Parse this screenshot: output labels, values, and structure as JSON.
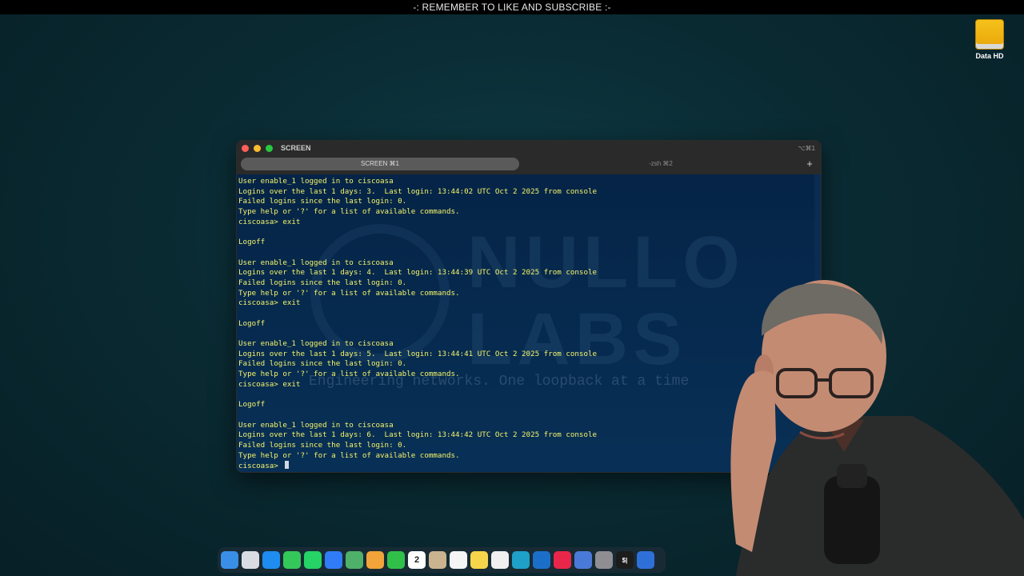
{
  "banner": "-: REMEMBER TO LIKE AND SUBSCRIBE :-",
  "desktop": {
    "drive_label": "Data HD"
  },
  "window": {
    "title": "SCREEN",
    "shortcut": "⌥⌘1",
    "tabs": [
      {
        "label": "SCREEN ⌘1",
        "active": true
      },
      {
        "label": "-zsh ⌘2",
        "active": false
      }
    ],
    "add_tab": "+"
  },
  "watermark": {
    "line1": "NULLO",
    "line2": "LABS",
    "tagline": "Engineering networks. One loopback at a time"
  },
  "terminal": {
    "lines": [
      "User enable_1 logged in to ciscoasa",
      "Logins over the last 1 days: 3.  Last login: 13:44:02 UTC Oct 2 2025 from console",
      "Failed logins since the last login: 0.",
      "Type help or '?' for a list of available commands.",
      "ciscoasa> exit",
      "",
      "Logoff",
      "",
      "User enable_1 logged in to ciscoasa",
      "Logins over the last 1 days: 4.  Last login: 13:44:39 UTC Oct 2 2025 from console",
      "Failed logins since the last login: 0.",
      "Type help or '?' for a list of available commands.",
      "ciscoasa> exit",
      "",
      "Logoff",
      "",
      "User enable_1 logged in to ciscoasa",
      "Logins over the last 1 days: 5.  Last login: 13:44:41 UTC Oct 2 2025 from console",
      "Failed logins since the last login: 0.",
      "Type help or '?' for a list of available commands.",
      "ciscoasa> exit",
      "",
      "Logoff",
      "",
      "User enable_1 logged in to ciscoasa",
      "Logins over the last 1 days: 6.  Last login: 13:44:42 UTC Oct 2 2025 from console",
      "Failed logins since the last login: 0.",
      "Type help or '?' for a list of available commands.",
      "ciscoasa> "
    ]
  },
  "dock": {
    "calendar_day": "2",
    "terminal_glyph": "$|",
    "icons": [
      {
        "name": "finder-icon",
        "color": "#3a8ee6"
      },
      {
        "name": "launchpad-icon",
        "color": "#d9dde3"
      },
      {
        "name": "app-store-icon",
        "color": "#1e8cf0"
      },
      {
        "name": "messages-icon",
        "color": "#34c759"
      },
      {
        "name": "whatsapp-icon",
        "color": "#25d366"
      },
      {
        "name": "mail-icon",
        "color": "#2f7cf6"
      },
      {
        "name": "maps-icon",
        "color": "#4fb06a"
      },
      {
        "name": "photos-icon",
        "color": "#f2a33a"
      },
      {
        "name": "facetime-icon",
        "color": "#30c04a"
      },
      {
        "name": "calendar-icon",
        "color": "#ffffff"
      },
      {
        "name": "contacts-icon",
        "color": "#c9b48f"
      },
      {
        "name": "reminders-icon",
        "color": "#f5f5f5"
      },
      {
        "name": "notes-icon",
        "color": "#f7d54a"
      },
      {
        "name": "freeform-icon",
        "color": "#f0f0f0"
      },
      {
        "name": "edge-icon",
        "color": "#1ea0c8"
      },
      {
        "name": "outlook-icon",
        "color": "#1b6fc8"
      },
      {
        "name": "music-icon",
        "color": "#e8264a"
      },
      {
        "name": "keynote-icon",
        "color": "#4a7ad8"
      },
      {
        "name": "settings-icon",
        "color": "#8e8e93"
      },
      {
        "name": "terminal-icon",
        "color": "#1c1c1c"
      },
      {
        "name": "app-icon",
        "color": "#2f6fd8"
      }
    ]
  },
  "colors": {
    "terminal_text": "#f4f46a",
    "terminal_bg": "#052447"
  }
}
